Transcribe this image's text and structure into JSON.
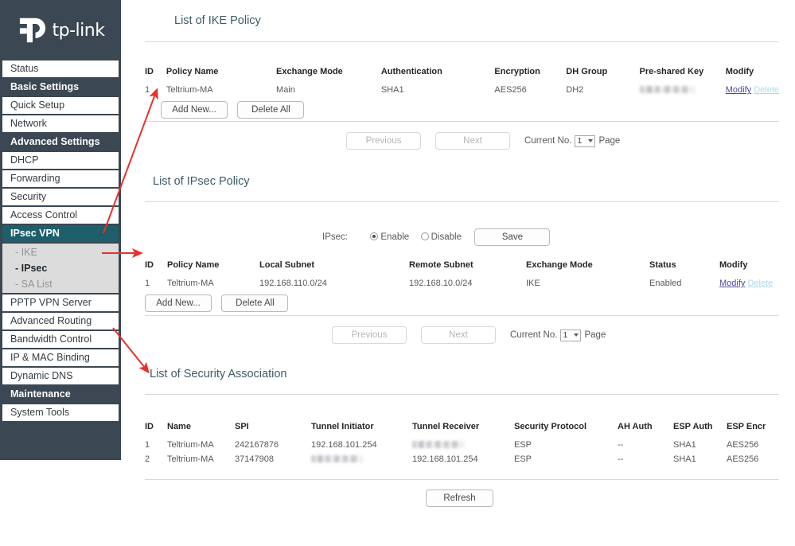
{
  "brand": {
    "name": "tp-link",
    "logo_icon": "tplink-logo-icon"
  },
  "sidebar": {
    "items": [
      {
        "label": "Status",
        "type": "item"
      },
      {
        "label": "Basic Settings",
        "type": "group"
      },
      {
        "label": "Quick Setup",
        "type": "item"
      },
      {
        "label": "Network",
        "type": "item"
      },
      {
        "label": "Advanced Settings",
        "type": "group"
      },
      {
        "label": "DHCP",
        "type": "item"
      },
      {
        "label": "Forwarding",
        "type": "item"
      },
      {
        "label": "Security",
        "type": "item"
      },
      {
        "label": "Access Control",
        "type": "item"
      },
      {
        "label": "IPsec VPN",
        "type": "active"
      },
      {
        "label": "- IKE",
        "type": "sub"
      },
      {
        "label": "- IPsec",
        "type": "sub-selected"
      },
      {
        "label": "- SA List",
        "type": "sub"
      },
      {
        "label": "PPTP VPN Server",
        "type": "item"
      },
      {
        "label": "Advanced Routing",
        "type": "item"
      },
      {
        "label": "Bandwidth Control",
        "type": "item"
      },
      {
        "label": "IP & MAC Binding",
        "type": "item"
      },
      {
        "label": "Dynamic DNS",
        "type": "item"
      },
      {
        "label": "Maintenance",
        "type": "group"
      },
      {
        "label": "System Tools",
        "type": "item"
      }
    ]
  },
  "ike_section": {
    "title": "List of IKE Policy",
    "headers": [
      "ID",
      "Policy Name",
      "Exchange Mode",
      "Authentication",
      "Encryption",
      "DH Group",
      "Pre-shared Key",
      "Modify"
    ],
    "rows": [
      {
        "id": "1",
        "policy_name": "Teltrium-MA",
        "exchange_mode": "Main",
        "authentication": "SHA1",
        "encryption": "AES256",
        "dh_group": "DH2",
        "pre_shared_key": "",
        "modify_label": "Modify",
        "delete_label": "Delete"
      }
    ],
    "add_new_label": "Add New...",
    "delete_all_label": "Delete All",
    "pager": {
      "previous_label": "Previous",
      "next_label": "Next",
      "current_no_label": "Current No.",
      "page_value": "1",
      "page_label": "Page"
    }
  },
  "ipsec_section": {
    "title": "List of IPsec Policy",
    "ipsec_label": "IPsec:",
    "enable_label": "Enable",
    "disable_label": "Disable",
    "save_label": "Save",
    "headers": [
      "ID",
      "Policy Name",
      "Local Subnet",
      "Remote Subnet",
      "Exchange Mode",
      "Status",
      "Modify"
    ],
    "rows": [
      {
        "id": "1",
        "policy_name": "Teltrium-MA",
        "local_subnet": "192.168.110.0/24",
        "remote_subnet": "192.168.10.0/24",
        "exchange_mode": "IKE",
        "status": "Enabled",
        "modify_label": "Modify",
        "delete_label": "Delete"
      }
    ],
    "add_new_label": "Add New...",
    "delete_all_label": "Delete All",
    "pager": {
      "previous_label": "Previous",
      "next_label": "Next",
      "current_no_label": "Current No.",
      "page_value": "1",
      "page_label": "Page"
    }
  },
  "sa_section": {
    "title": "List of Security Association",
    "headers": [
      "ID",
      "Name",
      "SPI",
      "Tunnel Initiator",
      "Tunnel Receiver",
      "Security Protocol",
      "AH Auth",
      "ESP Auth",
      "ESP Encr"
    ],
    "rows": [
      {
        "id": "1",
        "name": "Teltrium-MA",
        "spi": "242167876",
        "tunnel_initiator": "192.168.101.254",
        "tunnel_receiver": "",
        "security_protocol": "ESP",
        "ah_auth": "--",
        "esp_auth": "SHA1",
        "esp_encr": "AES256"
      },
      {
        "id": "2",
        "name": "Teltrium-MA",
        "spi": "37147908",
        "tunnel_initiator": "",
        "tunnel_receiver": "192.168.101.254",
        "security_protocol": "ESP",
        "ah_auth": "--",
        "esp_auth": "SHA1",
        "esp_encr": "AES256"
      }
    ],
    "refresh_label": "Refresh"
  },
  "annotations": {
    "arrow_color": "#e8312a",
    "arrows": [
      {
        "name": "arrow-ike-to-table"
      },
      {
        "name": "arrow-ipsec-to-table"
      },
      {
        "name": "arrow-salist-to-table"
      }
    ]
  },
  "colors": {
    "sidebar_bg": "#3b4752",
    "active_item": "#1e5f6b",
    "submenu_bg": "#dcdcdc",
    "section_title": "#3d5a66",
    "link": "#4a4a9e",
    "link_disabled": "#a9dce6"
  }
}
